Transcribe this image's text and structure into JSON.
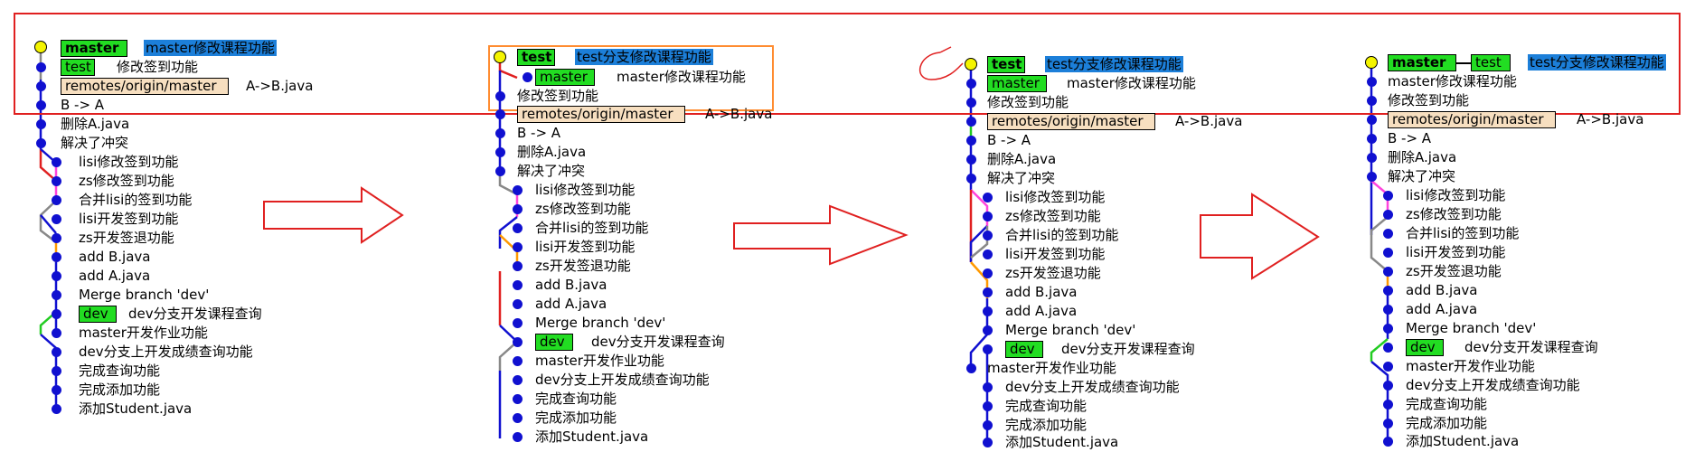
{
  "colors": {
    "commit_dot": "#1010d0",
    "head_dot": "#f4f400",
    "branch_tag": "#22dd22",
    "remote_tag": "#f7dfc0",
    "selected_message": "#1c7fd9",
    "red_frame": "#e02020",
    "orange_frame": "#ff8c30"
  },
  "panels": [
    {
      "id": "panel-1",
      "head_rows": [
        {
          "tags": [
            {
              "text": "master",
              "style": "green bold"
            }
          ],
          "message": "master修改课程功能",
          "selected": true
        },
        {
          "tags": [
            {
              "text": "test",
              "style": "green"
            }
          ],
          "message": "修改签到功能",
          "selected": false
        },
        {
          "tags": [
            {
              "text": "remotes/origin/master",
              "style": "tan"
            }
          ],
          "message": "A->B.java",
          "selected": false
        }
      ],
      "plain_rows": [
        "B -> A",
        "删除A.java",
        "解决了冲突"
      ],
      "branch_rows": [
        "lisi修改签到功能",
        "zs修改签到功能",
        "合并lisi的签到功能",
        "lisi开发签到功能",
        "zs开发签退功能",
        "add B.java",
        "add A.java",
        "Merge branch 'dev'"
      ],
      "dev_row": {
        "tag": "dev",
        "message": "dev分支开发课程查询"
      },
      "tail_rows": [
        "master开发作业功能",
        "dev分支上开发成绩查询功能",
        "完成查询功能",
        "完成添加功能",
        "添加Student.java"
      ]
    },
    {
      "id": "panel-2",
      "head_rows": [
        {
          "tags": [
            {
              "text": "test",
              "style": "green bold"
            }
          ],
          "message": "test分支修改课程功能",
          "selected": true
        },
        {
          "tags": [
            {
              "text": "master",
              "style": "green"
            }
          ],
          "message": "master修改课程功能",
          "selected": false
        }
      ],
      "message_row": "修改签到功能",
      "remote_row": {
        "tag": "remotes/origin/master",
        "message": "A->B.java"
      },
      "plain_rows": [
        "B -> A",
        "删除A.java",
        "解决了冲突"
      ],
      "branch_rows": [
        "lisi修改签到功能",
        "zs修改签到功能",
        "合并lisi的签到功能",
        "lisi开发签到功能",
        "zs开发签退功能",
        "add B.java",
        "add A.java",
        "Merge branch 'dev'"
      ],
      "dev_row": {
        "tag": "dev",
        "message": "dev分支开发课程查询"
      },
      "tail_rows": [
        "master开发作业功能",
        "dev分支上开发成绩查询功能",
        "完成查询功能",
        "完成添加功能",
        "添加Student.java"
      ]
    },
    {
      "id": "panel-3",
      "head_rows": [
        {
          "tags": [
            {
              "text": "test",
              "style": "green bold"
            }
          ],
          "message": "test分支修改课程功能",
          "selected": true
        },
        {
          "tags": [
            {
              "text": "master",
              "style": "green"
            }
          ],
          "message": "master修改课程功能",
          "selected": false
        }
      ],
      "message_row": "修改签到功能",
      "remote_row": {
        "tag": "remotes/origin/master",
        "message": "A->B.java"
      },
      "plain_rows": [
        "B -> A",
        "删除A.java",
        "解决了冲突"
      ],
      "branch_rows": [
        "lisi修改签到功能",
        "zs修改签到功能",
        "合并lisi的签到功能",
        "lisi开发签到功能",
        "zs开发签退功能",
        "add B.java",
        "add A.java",
        "Merge branch 'dev'"
      ],
      "dev_row": {
        "tag": "dev",
        "message": "dev分支开发课程查询"
      },
      "tail_rows": [
        "master开发作业功能",
        "dev分支上开发成绩查询功能",
        "完成查询功能",
        "完成添加功能",
        "添加Student.java"
      ]
    },
    {
      "id": "panel-4",
      "head_rows": [
        {
          "tags": [
            {
              "text": "master",
              "style": "green bold"
            },
            {
              "text": "test",
              "style": "green"
            }
          ],
          "message": "test分支修改课程功能",
          "selected": true
        }
      ],
      "message_rows": [
        "master修改课程功能",
        "修改签到功能"
      ],
      "remote_row": {
        "tag": "remotes/origin/master",
        "message": "A->B.java"
      },
      "plain_rows": [
        "B -> A",
        "删除A.java",
        "解决了冲突"
      ],
      "branch_rows": [
        "lisi修改签到功能",
        "zs修改签到功能",
        "合并lisi的签到功能",
        "lisi开发签到功能",
        "zs开发签退功能",
        "add B.java",
        "add A.java",
        "Merge branch 'dev'"
      ],
      "dev_row": {
        "tag": "dev",
        "message": "dev分支开发课程查询"
      },
      "tail_rows": [
        "master开发作业功能",
        "dev分支上开发成绩查询功能",
        "完成查询功能",
        "完成添加功能",
        "添加Student.java"
      ]
    }
  ],
  "arrows": [
    "right-arrow",
    "right-arrow",
    "right-arrow"
  ]
}
